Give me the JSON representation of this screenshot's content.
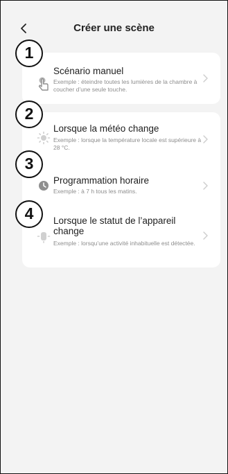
{
  "header": {
    "title": "Créer une scène"
  },
  "options": [
    {
      "number": "1",
      "label": "Scénario manuel",
      "desc": "Exemple : éteindre toutes les lumières de la chambre à coucher d’une seule touche.",
      "icon": "tap-hand-icon"
    },
    {
      "number": "2",
      "label": "Lorsque la météo change",
      "desc": "Exemple : lorsque la température locale est supérieure à 28 °C.",
      "icon": "sun-icon"
    },
    {
      "number": "3",
      "label": "Programmation horaire",
      "desc": "Exemple : à 7 h tous les matins.",
      "icon": "clock-icon"
    },
    {
      "number": "4",
      "label": "Lorsque le statut de l’appareil change",
      "desc": "Exemple : lorsqu’une activité inhabituelle est détectée.",
      "icon": "device-status-icon"
    }
  ],
  "colors": {
    "background": "#f3f3f3",
    "card": "#ffffff",
    "icon": "#8f8f8f",
    "chevron": "#cfcfcf"
  }
}
